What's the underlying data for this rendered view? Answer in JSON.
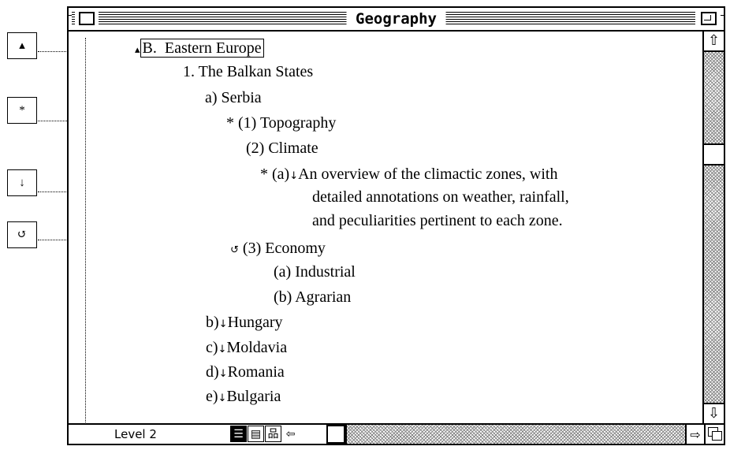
{
  "legend": [
    {
      "symbol": "▴",
      "name": "legend-collapse-icon"
    },
    {
      "symbol": "*",
      "name": "legend-asterisk-icon"
    },
    {
      "symbol": "↓",
      "name": "legend-down-arrow-icon"
    },
    {
      "symbol": "↺",
      "name": "legend-undo-icon"
    }
  ],
  "window": {
    "title": "Geography"
  },
  "outline": {
    "row1_marker": "▴",
    "row1_num": "B.",
    "row1_text": "Eastern Europe",
    "row2": "1.  The Balkan States",
    "row3": "a)  Serbia",
    "row4_marker": "*",
    "row4": "(1)  Topography",
    "row5": "(2)  Climate",
    "row6_marker": "*",
    "row6_num": "(a)",
    "row6_arrow": "↓",
    "row6_text": "An overview of the climactic zones, with",
    "row7": "detailed annotations on weather, rainfall,",
    "row8": "and peculiarities pertinent to each zone.",
    "row9_marker": "↺",
    "row9": "(3)  Economy",
    "row10": "(a)  Industrial",
    "row11": "(b)  Agrarian",
    "row12_num": "b)",
    "row12_arrow": "↓",
    "row12_text": "Hungary",
    "row13_num": "c)",
    "row13_arrow": "↓",
    "row13_text": "Moldavia",
    "row14_num": "d)",
    "row14_arrow": "↓",
    "row14_text": "Romania",
    "row15_num": "e)",
    "row15_arrow": "↓",
    "row15_text": "Bulgaria"
  },
  "scrollbar": {
    "up_arrow": "⇧",
    "down_arrow": "⇩",
    "right_arrow": "⇨",
    "left_arrow": "⇦"
  },
  "status": {
    "level": "Level 2",
    "icons": [
      "☰",
      "▤",
      "品",
      "⇦"
    ]
  }
}
